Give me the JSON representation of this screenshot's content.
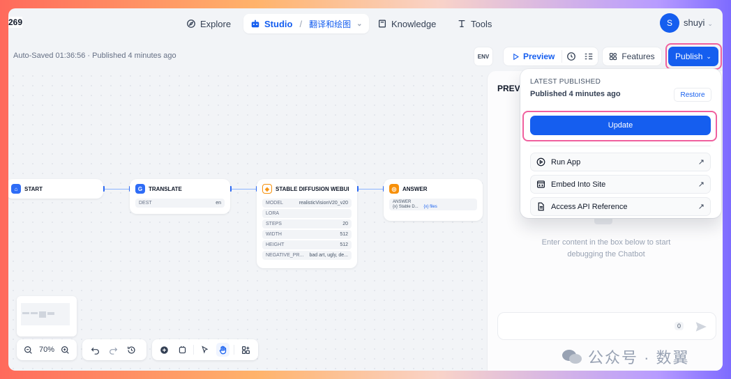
{
  "topnav": {
    "badge": "269",
    "explore_label": "Explore",
    "studio_label": "Studio",
    "app_name": "翻译和绘图",
    "knowledge_label": "Knowledge",
    "tools_label": "Tools",
    "avatar_initial": "S",
    "username": "shuyi"
  },
  "toolbar": {
    "autosave_status": "Auto-Saved 01:36:56 · Published 4 minutes ago",
    "env_label": "ENV",
    "preview_label": "Preview",
    "features_label": "Features",
    "publish_label": "Publish"
  },
  "workflow": {
    "nodes": {
      "start": {
        "title": "START"
      },
      "translate": {
        "title": "TRANSLATE",
        "params": [
          {
            "key": "DEST",
            "value": "en"
          }
        ]
      },
      "sd": {
        "title": "STABLE DIFFUSION WEBUI",
        "params": [
          {
            "key": "MODEL",
            "value": "realisticVisionV20_v20"
          },
          {
            "key": "LORA",
            "value": ""
          },
          {
            "key": "STEPS",
            "value": "20"
          },
          {
            "key": "WIDTH",
            "value": "512"
          },
          {
            "key": "HEIGHT",
            "value": "512"
          },
          {
            "key": "NEGATIVE_PR...",
            "value": "bad art, ugly, de..."
          }
        ]
      },
      "answer": {
        "title": "ANSWER",
        "field_label": "ANSWER",
        "var1": "Stable D...",
        "var2": "files"
      }
    }
  },
  "controls": {
    "zoom": "70%"
  },
  "preview_panel": {
    "title": "PREV",
    "empty_text": "Enter content in the box below to start debugging the Chatbot",
    "char_count": "0"
  },
  "publish_menu": {
    "latest_label": "LATEST PUBLISHED",
    "published_time": "Published 4 minutes ago",
    "restore_label": "Restore",
    "update_label": "Update",
    "run_app": "Run App",
    "embed": "Embed Into Site",
    "api_ref": "Access API Reference"
  },
  "watermark": {
    "text": "公众号 · 数翼"
  },
  "colors": {
    "accent": "#155eef",
    "highlight": "#f0609e"
  }
}
